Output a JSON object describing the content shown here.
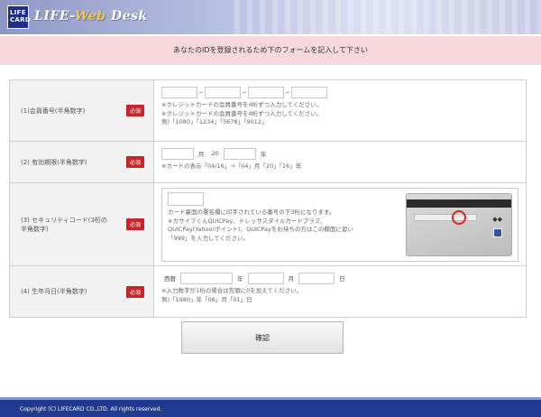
{
  "header": {
    "logo_box": "LIFE CARD",
    "logo_prefix": "LIFE-",
    "logo_mid": "Web",
    "logo_suffix": " Desk"
  },
  "notice": "あなたのIDを登録されるため下のフォームを記入して下さい",
  "required_badge": "必須",
  "fields": {
    "card_number": {
      "label": "(1)会員番号(半角数字)",
      "note1": "※クレジットカードの会員番号を4桁ずつ入力してください。",
      "note2": "※クレジットカードの会員番号を4桁ずつ入力してください。",
      "example": "例)「1080」「1234」「5678」「9012」"
    },
    "expiry": {
      "label": "(2) 有効期限(半角数字)",
      "month_unit": "月",
      "year_prefix": "20",
      "year_unit": "年",
      "note": "※カードの表示「04/16」→「04」月「20」「16」年"
    },
    "security_code": {
      "label": "(3) セキュリティコード(3桁の半角数字)",
      "note1": "カード裏面の署名欄に印字されている番号の下3桁になります。",
      "note2": "※カサイフくんQUICPay、ドレッサスタイルカードプラス、",
      "note3": "QUICPay(Yahoo!ポイント)、QUICPayをお持ちの方はこの欄面に習い",
      "note4": "「999」を入力してください。"
    },
    "birthdate": {
      "label": "(4) 生年月日(半角数字)",
      "era_label": "西暦",
      "year_unit": "年",
      "month_unit": "月",
      "day_unit": "日",
      "note1": "※入力数字が1桁の場合は先頭に0を加えてください。",
      "example": "例)「1980」年「06」月「01」日"
    }
  },
  "confirm_button": "確認",
  "footer": "Copyright (C) LIFECARD CO.,LTD. All rights reserved."
}
